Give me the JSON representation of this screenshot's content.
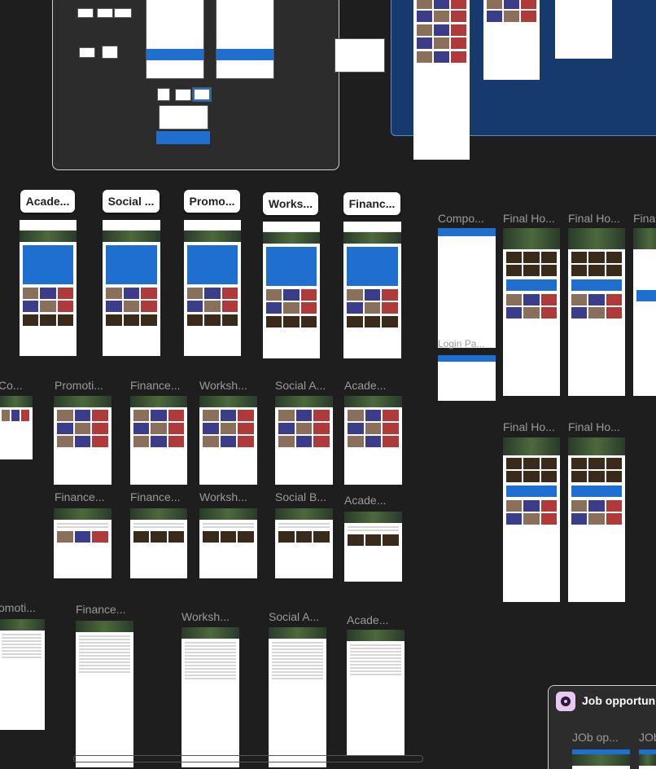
{
  "canvas": {
    "background": "#1e1e1e",
    "section_labels": {
      "academic_1": "Acade...",
      "social_1": "Social ...",
      "promo_1": "Promo...",
      "works_1": "Works...",
      "financ_1": "Financ..."
    },
    "frame_labels": {
      "compo": "Compo...",
      "final_ho_1": "Final Ho...",
      "final_ho_2": "Final Ho...",
      "fina_3": "Fina",
      "login": "Login Pa...",
      "co": "Co...",
      "promoti": "Promoti...",
      "finance_1": "Finance...",
      "worksh_1": "Worksh...",
      "social_a_1": "Social A...",
      "acade_1": "Acade...",
      "final_ho_3": "Final Ho...",
      "final_ho_4": "Final Ho...",
      "finance_2": "Finance...",
      "finance_3": "Finance...",
      "worksh_2": "Worksh...",
      "social_b": "Social B...",
      "acade_2": "Acade...",
      "omoti": "omoti...",
      "finance_4": "Finance...",
      "worksh_3": "Worksh...",
      "social_a_2": "Social A...",
      "acade_3": "Acade..."
    },
    "job_section": {
      "title": "Job opportuni",
      "frame_1": "JOb op...",
      "frame_2": "JOb"
    }
  },
  "colors": {
    "accent_blue": "#1f6fd0",
    "section_blue": "#163a6b",
    "job_icon": "#e6c8f0"
  }
}
